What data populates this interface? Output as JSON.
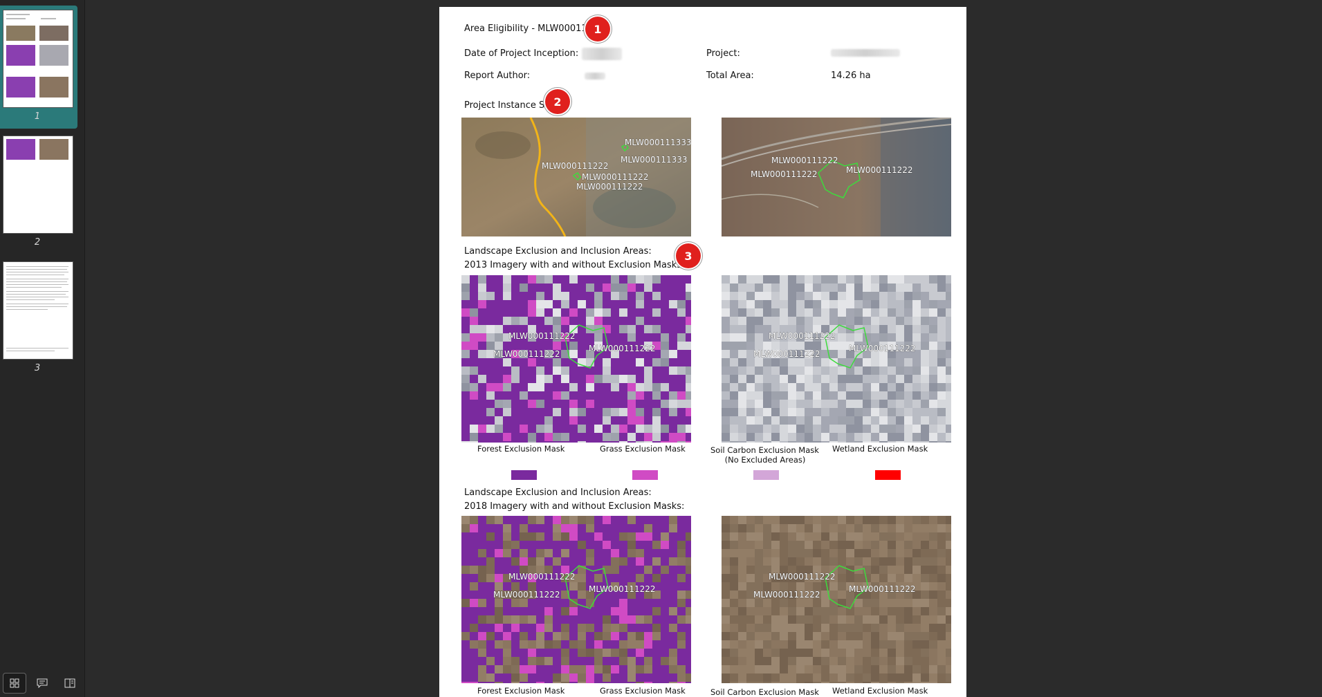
{
  "sidebar": {
    "pages": [
      {
        "number": "1"
      },
      {
        "number": "2"
      },
      {
        "number": "3"
      }
    ],
    "footer": {
      "grid_icon": "grid-icon",
      "comment_icon": "comment-icon",
      "panel_icon": "panel-icon"
    }
  },
  "report": {
    "title": "Area Eligibility - MLW000111222",
    "fields": {
      "date_label": "Date of Project Inception:",
      "project_label": "Project:",
      "author_label": "Report Author:",
      "area_label": "Total Area:",
      "area_value": "14.26 ha"
    },
    "badges": [
      "1",
      "2",
      "3"
    ],
    "sites_heading": "Project Instance Sites:",
    "map_labels": {
      "a": "MLW000111333",
      "b": "MLW000111333",
      "c": "MLW000111222",
      "d": "MLW000111222",
      "e": "MLW000111222",
      "f": "MLW000111222",
      "g": "MLW000111222",
      "h": "MLW000111222"
    },
    "section_2013": {
      "heading1": "Landscape Exclusion and Inclusion Areas:",
      "heading2": "2013 Imagery with and without Exclusion Masks:"
    },
    "section_2018": {
      "heading1": "Landscape Exclusion and Inclusion Areas:",
      "heading2": "2018 Imagery with and without Exclusion Masks:"
    },
    "site_label": "MLW000111222",
    "legend": {
      "forest": "Forest Exclusion Mask",
      "grass": "Grass Exclusion Mask",
      "soil": "Soil Carbon Exclusion Mask",
      "soil_note": "(No Excluded Areas)",
      "wetland": "Wetland Exclusion Mask"
    },
    "colors": {
      "forest": "#7a2a9e",
      "grass": "#d04bc4",
      "soil": "#d3a6d8",
      "wetland": "#ff0000",
      "boundary": "#3ddc3d",
      "river": "#f2b418",
      "badge": "#e0201d"
    }
  }
}
